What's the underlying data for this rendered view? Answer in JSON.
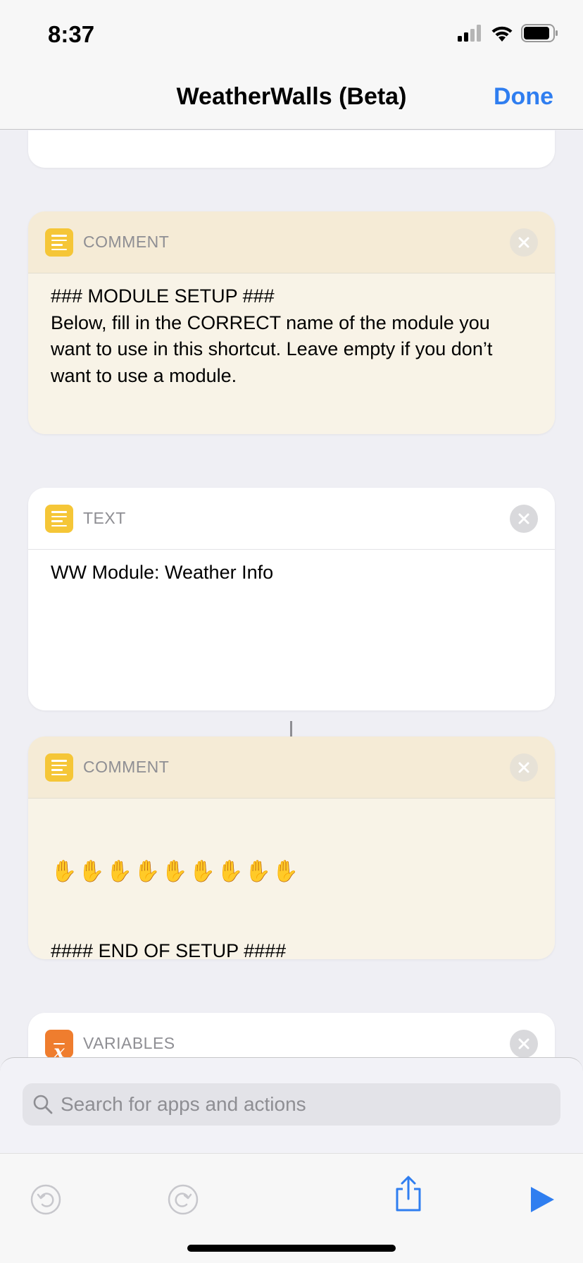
{
  "status_bar": {
    "time": "8:37"
  },
  "nav": {
    "title": "WeatherWalls (Beta)",
    "done_label": "Done"
  },
  "actions": [
    {
      "label": "COMMENT",
      "text": "### MODULE SETUP ###\nBelow, fill in the CORRECT name of the module you want to use in this shortcut. Leave empty if you don’t want to use a module."
    },
    {
      "label": "TEXT",
      "text": "WW Module: Weather Info"
    },
    {
      "label": "COMMENT",
      "emoji_line": "✋✋✋✋✋✋✋✋✋",
      "text": "#### END OF SETUP ####\nIf you want to update the wallpaper on your lockscreen, homescreen or both, scroll downl to the last action and change it there."
    },
    {
      "label": "VARIABLES"
    }
  ],
  "search": {
    "placeholder": "Search for apps and actions"
  },
  "colors": {
    "accent": "#2f7ef0",
    "comment_bg": "#f8f3e7",
    "text_icon": "#f5c637",
    "variables_icon": "#ef7d2e"
  }
}
